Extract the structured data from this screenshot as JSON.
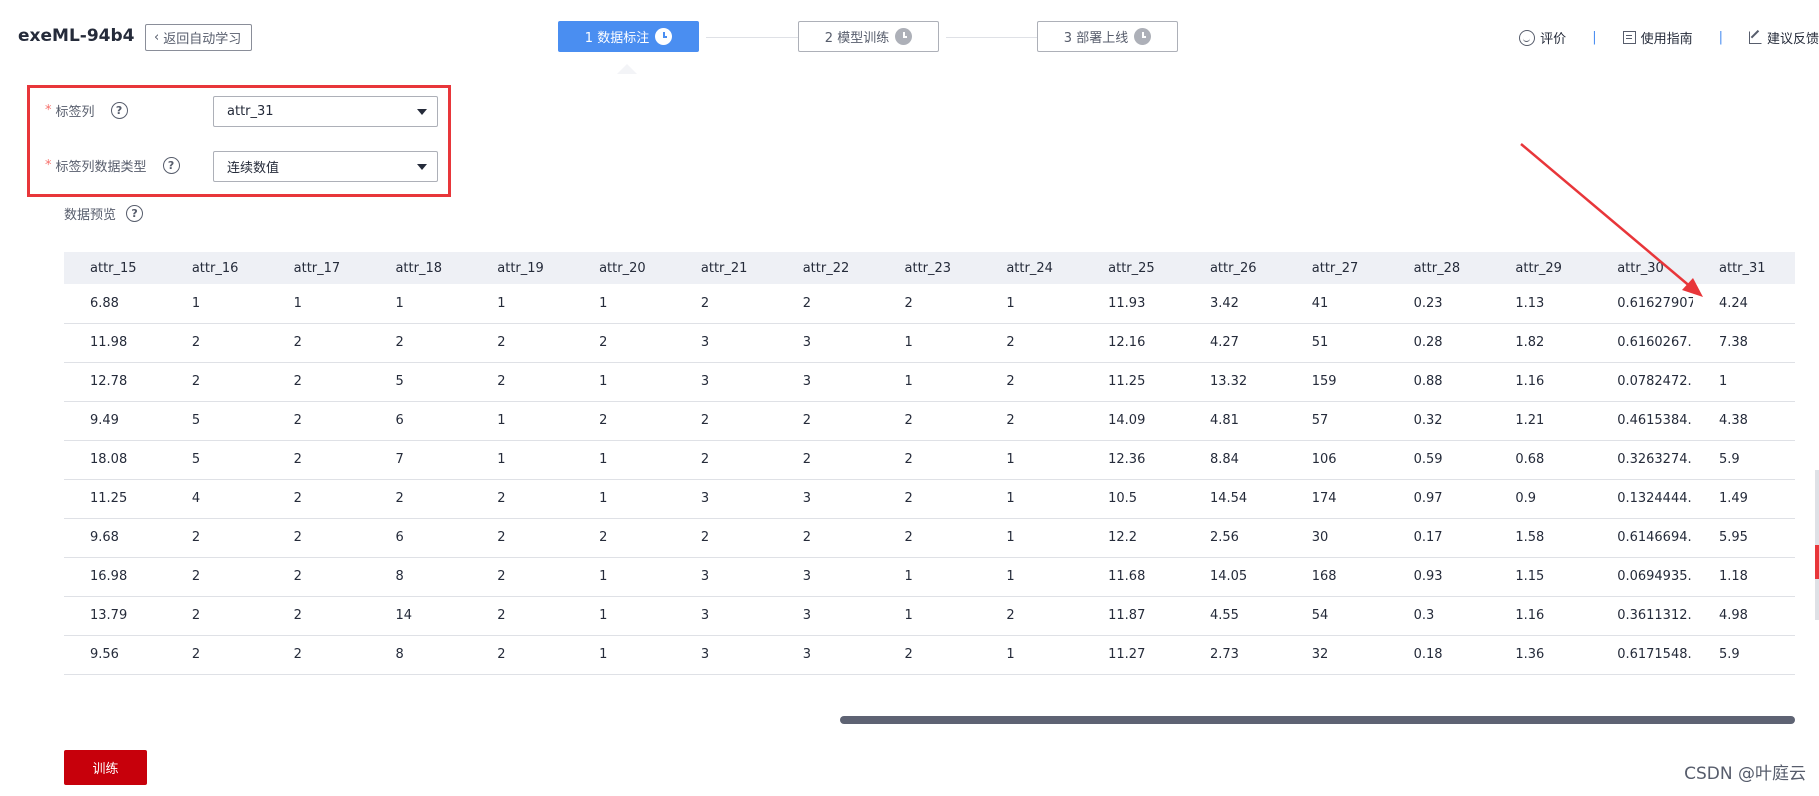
{
  "header": {
    "app_title": "exeML-94b4",
    "back_label": "返回自动学习",
    "steps": [
      {
        "label": "1 数据标注",
        "state": "active"
      },
      {
        "label": "2 模型训练",
        "state": "pending"
      },
      {
        "label": "3 部署上线",
        "state": "pending"
      }
    ],
    "links": {
      "rate": "评价",
      "guide": "使用指南",
      "feedback": "建议反馈"
    }
  },
  "form": {
    "label_column": {
      "label": "标签列",
      "value": "attr_31"
    },
    "label_type": {
      "label": "标签列数据类型",
      "value": "连续数值"
    },
    "help_glyph": "?"
  },
  "preview": {
    "label": "数据预览",
    "columns": [
      "attr_15",
      "attr_16",
      "attr_17",
      "attr_18",
      "attr_19",
      "attr_20",
      "attr_21",
      "attr_22",
      "attr_23",
      "attr_24",
      "attr_25",
      "attr_26",
      "attr_27",
      "attr_28",
      "attr_29",
      "attr_30",
      "attr_31"
    ],
    "rows": [
      [
        "6.88",
        "1",
        "1",
        "1",
        "1",
        "1",
        "2",
        "2",
        "2",
        "1",
        "11.93",
        "3.42",
        "41",
        "0.23",
        "1.13",
        "0.61627907",
        "4.24"
      ],
      [
        "11.98",
        "2",
        "2",
        "2",
        "2",
        "2",
        "3",
        "3",
        "1",
        "2",
        "12.16",
        "4.27",
        "51",
        "0.28",
        "1.82",
        "0.6160267...",
        "7.38"
      ],
      [
        "12.78",
        "2",
        "2",
        "5",
        "2",
        "1",
        "3",
        "3",
        "1",
        "2",
        "11.25",
        "13.32",
        "159",
        "0.88",
        "1.16",
        "0.0782472...",
        "1"
      ],
      [
        "9.49",
        "5",
        "2",
        "6",
        "1",
        "2",
        "2",
        "2",
        "2",
        "2",
        "14.09",
        "4.81",
        "57",
        "0.32",
        "1.21",
        "0.4615384...",
        "4.38"
      ],
      [
        "18.08",
        "5",
        "2",
        "7",
        "1",
        "1",
        "2",
        "2",
        "2",
        "1",
        "12.36",
        "8.84",
        "106",
        "0.59",
        "0.68",
        "0.3263274...",
        "5.9"
      ],
      [
        "11.25",
        "4",
        "2",
        "2",
        "2",
        "1",
        "3",
        "3",
        "2",
        "1",
        "10.5",
        "14.54",
        "174",
        "0.97",
        "0.9",
        "0.1324444...",
        "1.49"
      ],
      [
        "9.68",
        "2",
        "2",
        "6",
        "2",
        "2",
        "2",
        "2",
        "2",
        "1",
        "12.2",
        "2.56",
        "30",
        "0.17",
        "1.58",
        "0.6146694...",
        "5.95"
      ],
      [
        "16.98",
        "2",
        "2",
        "8",
        "2",
        "1",
        "3",
        "3",
        "1",
        "1",
        "11.68",
        "14.05",
        "168",
        "0.93",
        "1.15",
        "0.0694935...",
        "1.18"
      ],
      [
        "13.79",
        "2",
        "2",
        "14",
        "2",
        "1",
        "3",
        "3",
        "1",
        "2",
        "11.87",
        "4.55",
        "54",
        "0.3",
        "1.16",
        "0.3611312...",
        "4.98"
      ],
      [
        "9.56",
        "2",
        "2",
        "8",
        "2",
        "1",
        "3",
        "3",
        "2",
        "1",
        "11.27",
        "2.73",
        "32",
        "0.18",
        "1.36",
        "0.6171548...",
        "5.9"
      ]
    ]
  },
  "actions": {
    "train": "训练"
  },
  "watermark": "CSDN @叶庭云",
  "colors": {
    "accent": "#4a8ef1",
    "primary_button": "#c7000b",
    "annotation": "#e8363a"
  }
}
